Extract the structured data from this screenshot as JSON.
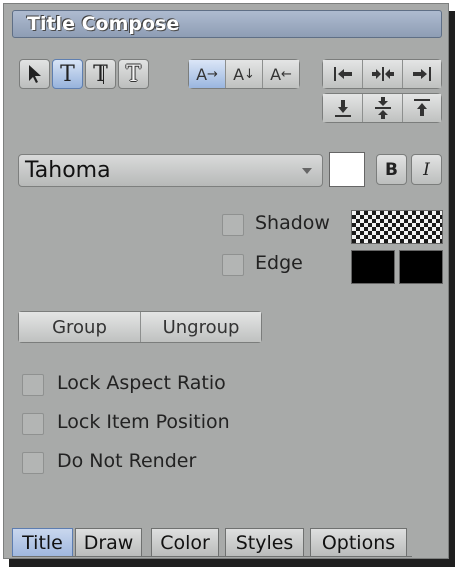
{
  "panel": {
    "title": "Title Compose"
  },
  "tools": {
    "pointer_icon": "arrow-pointer-icon",
    "text_glyph": "T",
    "text_vertical_glyph": "T",
    "text_outline_glyph": "T"
  },
  "text_direction": {
    "right": {
      "glyph": "A",
      "arrow": "→"
    },
    "down": {
      "glyph": "A",
      "arrow": "↓"
    },
    "left": {
      "glyph": "A",
      "arrow": "←"
    }
  },
  "font": {
    "family": "Tahoma",
    "color": "#ffffff",
    "bold_label": "B",
    "italic_label": "I"
  },
  "shadow": {
    "label": "Shadow",
    "checked": false
  },
  "edge": {
    "label": "Edge",
    "checked": false,
    "colors": [
      "#000000",
      "#000000"
    ]
  },
  "grouping": {
    "group_label": "Group",
    "ungroup_label": "Ungroup"
  },
  "options": [
    {
      "label": "Lock Aspect Ratio",
      "checked": false
    },
    {
      "label": "Lock Item Position",
      "checked": false
    },
    {
      "label": "Do Not Render",
      "checked": false
    }
  ],
  "tabs": [
    {
      "label": "Title",
      "active": true
    },
    {
      "label": "Draw",
      "active": false
    },
    {
      "label": "Color",
      "active": false
    },
    {
      "label": "Styles",
      "active": false
    },
    {
      "label": "Options",
      "active": false
    }
  ]
}
